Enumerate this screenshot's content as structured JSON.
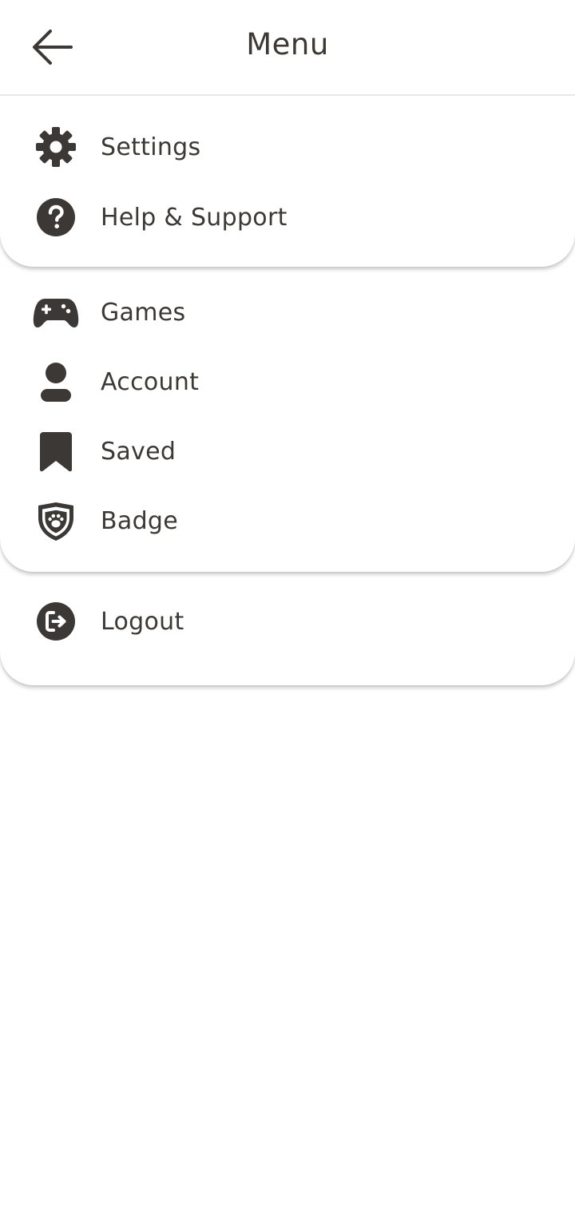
{
  "header": {
    "title": "Menu",
    "back_icon": "arrow-left-icon"
  },
  "colors": {
    "text": "#3b3835",
    "icon": "#3b3835",
    "divider": "#e9e7e5",
    "background": "#ffffff"
  },
  "groups": [
    {
      "items": [
        {
          "label": "Settings",
          "icon": "gear-icon"
        },
        {
          "label": "Help & Support",
          "icon": "question-circle-icon"
        }
      ]
    },
    {
      "items": [
        {
          "label": "Games",
          "icon": "gamepad-icon"
        },
        {
          "label": "Account",
          "icon": "user-icon"
        },
        {
          "label": "Saved",
          "icon": "bookmark-icon"
        },
        {
          "label": "Badge",
          "icon": "paw-shield-icon"
        }
      ]
    },
    {
      "items": [
        {
          "label": "Logout",
          "icon": "logout-icon"
        }
      ]
    }
  ]
}
